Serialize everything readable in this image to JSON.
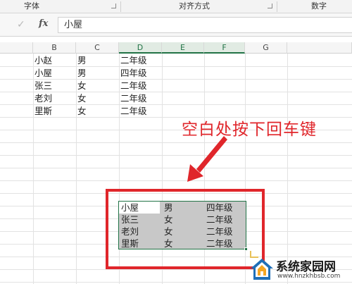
{
  "ribbon": {
    "groups": [
      {
        "label": "字体"
      },
      {
        "label": "对齐方式"
      },
      {
        "label": "数字"
      }
    ]
  },
  "formula_bar": {
    "check_icon": "checkmark-icon",
    "fx_label": "fx",
    "value": "小屋"
  },
  "sheet": {
    "columns": [
      "B",
      "C",
      "D",
      "E",
      "F",
      "G"
    ],
    "selected_columns": [
      "D",
      "E",
      "F"
    ],
    "rows": [
      {
        "name": "小赵",
        "gender": "男",
        "grade": "二年级"
      },
      {
        "name": "小屋",
        "gender": "男",
        "grade": "四年级"
      },
      {
        "name": "张三",
        "gender": "女",
        "grade": "二年级"
      },
      {
        "name": "老刘",
        "gender": "女",
        "grade": "二年级"
      },
      {
        "name": "里斯",
        "gender": "女",
        "grade": "二年级"
      }
    ],
    "pasted_rows": [
      {
        "name": "小屋",
        "gender": "男",
        "grade": "四年级"
      },
      {
        "name": "张三",
        "gender": "女",
        "grade": "二年级"
      },
      {
        "name": "老刘",
        "gender": "女",
        "grade": "二年级"
      },
      {
        "name": "里斯",
        "gender": "女",
        "grade": "二年级"
      }
    ]
  },
  "annotation": {
    "text": "空白处按下回车键",
    "color": "#e0262b"
  },
  "watermark": {
    "title": "系统家园网",
    "url": "www.hnzkhbsb.com",
    "icon": "house-logo-icon"
  },
  "colors": {
    "accent": "#217346",
    "annotation": "#e0262b",
    "selection_fill": "#c8c8c8"
  }
}
